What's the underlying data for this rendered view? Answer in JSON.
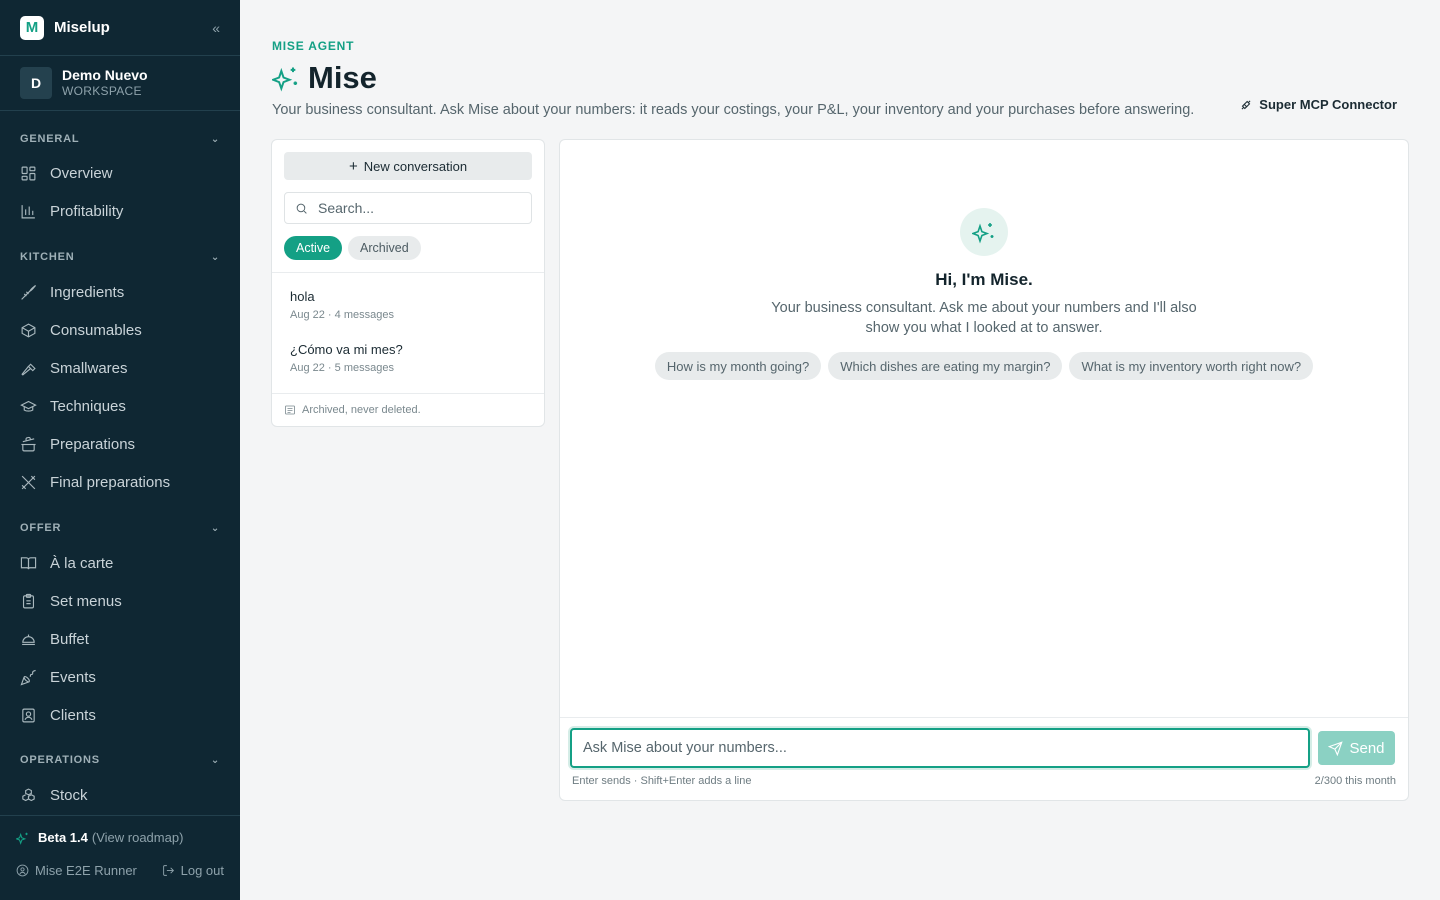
{
  "brand": {
    "logo_letter": "M",
    "name": "Miselup",
    "collapse_icon": "double-chevron-left-icon"
  },
  "workspace": {
    "avatar": "D",
    "name": "Demo Nuevo",
    "label": "WORKSPACE"
  },
  "sidebar": {
    "sections": [
      {
        "title": "GENERAL",
        "items": [
          {
            "label": "Overview",
            "icon": "grid-icon"
          },
          {
            "label": "Profitability",
            "icon": "bar-chart-icon"
          }
        ]
      },
      {
        "title": "KITCHEN",
        "items": [
          {
            "label": "Ingredients",
            "icon": "carrot-icon"
          },
          {
            "label": "Consumables",
            "icon": "box-icon"
          },
          {
            "label": "Smallwares",
            "icon": "hammer-icon"
          },
          {
            "label": "Techniques",
            "icon": "graduation-cap-icon"
          },
          {
            "label": "Preparations",
            "icon": "cooking-pot-icon"
          },
          {
            "label": "Final preparations",
            "icon": "utensils-icon"
          }
        ]
      },
      {
        "title": "OFFER",
        "items": [
          {
            "label": "À la carte",
            "icon": "book-open-icon"
          },
          {
            "label": "Set menus",
            "icon": "clipboard-icon"
          },
          {
            "label": "Buffet",
            "icon": "cloche-icon"
          },
          {
            "label": "Events",
            "icon": "party-popper-icon"
          },
          {
            "label": "Clients",
            "icon": "contact-icon"
          }
        ]
      },
      {
        "title": "OPERATIONS",
        "items": [
          {
            "label": "Stock",
            "icon": "boxes-icon"
          }
        ]
      }
    ],
    "footer": {
      "beta_label": "Beta 1.4",
      "roadmap_link": "(View roadmap)",
      "user": "Mise E2E Runner",
      "logout": "Log out"
    }
  },
  "header": {
    "eyebrow": "MISE AGENT",
    "title": "Mise",
    "subtitle": "Your business consultant. Ask Mise about your numbers: it reads your costings, your P&L, your inventory and your purchases before answering.",
    "mcp_link": "Super MCP Connector"
  },
  "conversations": {
    "new_button": "New conversation",
    "search_placeholder": "Search...",
    "filters": {
      "active": "Active",
      "archived": "Archived"
    },
    "items": [
      {
        "title": "hola",
        "meta": "Aug 22 · 4 messages"
      },
      {
        "title": "¿Cómo va mi mes?",
        "meta": "Aug 22 · 5 messages"
      }
    ],
    "footer_note": "Archived, never deleted."
  },
  "chat": {
    "greeting": "Hi, I'm Mise.",
    "intro": "Your business consultant. Ask me about your numbers and I'll also show you what I looked at to answer.",
    "suggestions": [
      "How is my month going?",
      "Which dishes are eating my margin?",
      "What is my inventory worth right now?"
    ],
    "input_placeholder": "Ask Mise about your numbers...",
    "send_label": "Send",
    "hint": "Enter sends · Shift+Enter adds a line",
    "quota": "2/300 this month"
  },
  "colors": {
    "accent": "#14a085",
    "sidebar_bg": "#0f2733",
    "page_bg": "#f4f5f6"
  }
}
